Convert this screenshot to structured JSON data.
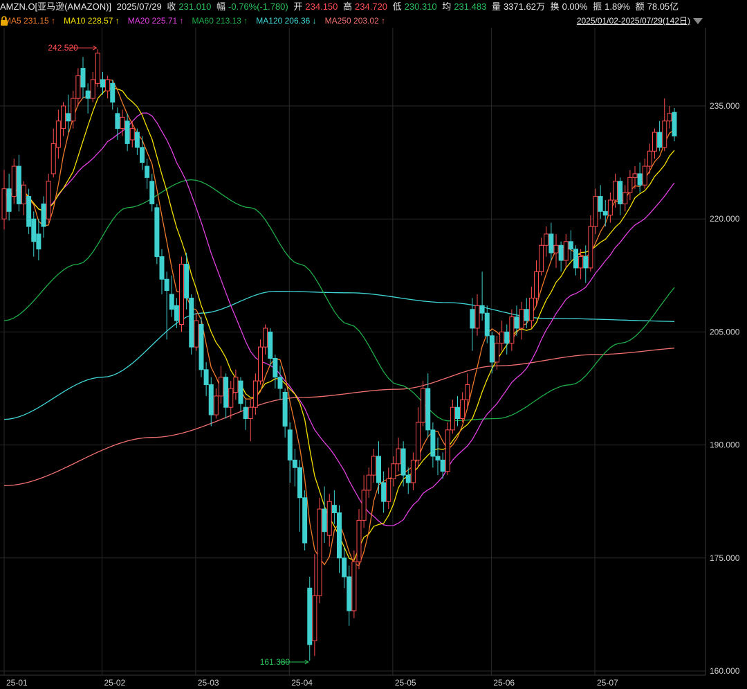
{
  "header": {
    "symbol": "AMZN.O[亚马逊(AMAZON)]",
    "date": "2025/07/29",
    "close_label": "收",
    "close": "231.010",
    "change_label": "幅",
    "change": "-0.76%(-1.780)",
    "open_label": "开",
    "open": "234.150",
    "high_label": "高",
    "high": "234.720",
    "low_label": "低",
    "low": "230.310",
    "avg_label": "均",
    "avg": "231.483",
    "volume_label": "量",
    "volume": "3371.62万",
    "turnover_label": "换",
    "turnover": "0.00%",
    "amplitude_label": "振",
    "amplitude": "1.89%",
    "amount_label": "额",
    "amount": "78.05亿"
  },
  "ma_legend": [
    {
      "label": "MA5",
      "value": "231.15",
      "arrow": "↑",
      "color": "#f07a2a"
    },
    {
      "label": "MA10",
      "value": "228.57",
      "arrow": "↑",
      "color": "#f5e100"
    },
    {
      "label": "MA20",
      "value": "225.71",
      "arrow": "↑",
      "color": "#e040e0"
    },
    {
      "label": "MA60",
      "value": "213.13",
      "arrow": "↑",
      "color": "#1fae4a"
    },
    {
      "label": "MA120",
      "value": "206.36",
      "arrow": "↓",
      "color": "#40d6d6"
    },
    {
      "label": "MA250",
      "value": "203.02",
      "arrow": "↑",
      "color": "#f07070"
    }
  ],
  "range_label": "2025/01/02-2025/07/29(142日)",
  "colors": {
    "up": "#ff4d4f",
    "down": "#3fd0d0",
    "grid": "#2a2a2a",
    "bg": "#000000"
  },
  "icons": [
    "dropdown-arrow-icon",
    "lock-icon"
  ],
  "chart_data": {
    "type": "candlestick",
    "ylim": [
      160,
      242.6
    ],
    "y_ticks": [
      "235.000",
      "220.000",
      "205.000",
      "190.000",
      "175.000",
      "160.000"
    ],
    "x_ticks": [
      "25-01",
      "25-02",
      "25-03",
      "25-04",
      "25-05",
      "25-06",
      "25-07"
    ],
    "annotations": [
      {
        "text": "242.520",
        "kind": "high",
        "value": 242.52
      },
      {
        "text": "161.380",
        "kind": "low",
        "value": 161.38
      }
    ],
    "candles": [
      [
        220.0,
        224.0,
        226.5,
        218.6
      ],
      [
        224.0,
        221.0,
        226.0,
        219.8
      ],
      [
        223.0,
        227.0,
        228.0,
        222.0
      ],
      [
        227.0,
        222.0,
        228.5,
        221.0
      ],
      [
        222.0,
        224.5,
        225.0,
        220.5
      ],
      [
        223.0,
        219.0,
        224.0,
        218.0
      ],
      [
        220.0,
        217.0,
        221.0,
        215.0
      ],
      [
        218.0,
        216.0,
        220.0,
        214.5
      ],
      [
        222.0,
        219.0,
        223.0,
        217.5
      ],
      [
        220.0,
        225.0,
        226.0,
        219.5
      ],
      [
        226.0,
        230.0,
        232.0,
        225.5
      ],
      [
        229.5,
        233.0,
        234.5,
        228.0
      ],
      [
        232.0,
        235.0,
        235.5,
        231.0
      ],
      [
        234.0,
        233.0,
        236.5,
        231.5
      ],
      [
        233.0,
        236.0,
        237.0,
        232.0
      ],
      [
        236.0,
        239.0,
        240.0,
        235.0
      ],
      [
        240.0,
        237.5,
        241.5,
        236.0
      ],
      [
        237.0,
        236.0,
        238.0,
        234.0
      ],
      [
        236.0,
        238.5,
        239.5,
        235.5
      ],
      [
        238.0,
        242.0,
        242.52,
        237.5
      ],
      [
        238.5,
        237.5,
        239.5,
        236.5
      ],
      [
        237.0,
        238.5,
        239.0,
        236.0
      ],
      [
        238.0,
        235.5,
        238.5,
        234.5
      ],
      [
        234.0,
        232.0,
        234.8,
        230.5
      ],
      [
        232.0,
        233.5,
        234.5,
        231.0
      ],
      [
        233.0,
        230.0,
        234.0,
        229.0
      ],
      [
        230.5,
        232.0,
        233.0,
        229.5
      ],
      [
        231.5,
        229.5,
        232.0,
        228.5
      ],
      [
        229.5,
        227.5,
        231.0,
        226.5
      ],
      [
        227.0,
        225.5,
        228.0,
        224.0
      ],
      [
        225.0,
        222.0,
        226.0,
        221.0
      ],
      [
        221.5,
        215.0,
        222.0,
        214.0
      ],
      [
        215.0,
        212.0,
        216.0,
        210.0
      ],
      [
        212.0,
        210.5,
        213.0,
        204.0
      ],
      [
        210.0,
        208.0,
        212.5,
        207.0
      ],
      [
        208.5,
        206.5,
        209.5,
        205.5
      ],
      [
        206.0,
        214.0,
        215.0,
        205.0
      ],
      [
        214.0,
        209.5,
        215.5,
        208.0
      ],
      [
        209.5,
        203.0,
        210.0,
        202.0
      ],
      [
        203.0,
        206.5,
        207.5,
        202.5
      ],
      [
        206.0,
        200.0,
        207.0,
        199.0
      ],
      [
        200.0,
        198.0,
        201.0,
        196.5
      ],
      [
        198.0,
        194.0,
        199.0,
        192.5
      ],
      [
        194.0,
        196.5,
        197.5,
        193.5
      ],
      [
        196.5,
        199.0,
        200.5,
        195.5
      ],
      [
        199.0,
        195.0,
        199.5,
        193.5
      ],
      [
        195.0,
        197.5,
        198.5,
        193.5
      ],
      [
        197.0,
        199.0,
        200.0,
        196.0
      ],
      [
        198.5,
        195.5,
        199.0,
        194.5
      ],
      [
        195.0,
        193.5,
        196.0,
        192.0
      ],
      [
        193.5,
        195.0,
        196.0,
        190.5
      ],
      [
        195.0,
        198.5,
        199.5,
        194.0
      ],
      [
        198.5,
        203.0,
        204.0,
        198.0
      ],
      [
        203.0,
        205.5,
        206.0,
        202.0
      ],
      [
        205.0,
        201.5,
        205.5,
        200.5
      ],
      [
        201.5,
        199.0,
        202.0,
        197.5
      ],
      [
        199.0,
        197.5,
        200.5,
        196.0
      ],
      [
        197.0,
        192.5,
        197.5,
        191.0
      ],
      [
        192.0,
        188.0,
        193.0,
        185.0
      ],
      [
        188.0,
        187.0,
        189.5,
        184.5
      ],
      [
        187.0,
        183.0,
        188.0,
        178.5
      ],
      [
        183.0,
        177.0,
        184.0,
        176.0
      ],
      [
        171.0,
        163.5,
        172.5,
        161.38
      ],
      [
        164.0,
        170.0,
        175.5,
        162.0
      ],
      [
        170.0,
        181.5,
        183.0,
        169.0
      ],
      [
        181.5,
        178.5,
        184.5,
        177.0
      ],
      [
        178.0,
        182.5,
        183.5,
        176.5
      ],
      [
        182.0,
        181.0,
        184.0,
        179.5
      ],
      [
        181.0,
        175.0,
        182.0,
        173.0
      ],
      [
        175.0,
        172.5,
        176.5,
        171.0
      ],
      [
        172.5,
        168.0,
        174.0,
        166.0
      ],
      [
        168.0,
        174.5,
        176.0,
        167.0
      ],
      [
        174.5,
        180.0,
        181.5,
        173.5
      ],
      [
        180.0,
        184.0,
        186.0,
        179.0
      ],
      [
        184.0,
        186.0,
        187.0,
        183.0
      ],
      [
        186.0,
        188.5,
        189.5,
        185.0
      ],
      [
        188.5,
        185.0,
        190.5,
        183.5
      ],
      [
        185.0,
        182.5,
        186.5,
        181.0
      ],
      [
        182.5,
        185.5,
        187.0,
        181.5
      ],
      [
        185.5,
        187.5,
        188.5,
        184.5
      ],
      [
        187.5,
        189.5,
        191.0,
        186.5
      ],
      [
        189.5,
        186.0,
        190.5,
        184.5
      ],
      [
        186.0,
        185.0,
        187.0,
        183.5
      ],
      [
        185.0,
        188.0,
        189.0,
        184.0
      ],
      [
        188.0,
        193.0,
        195.0,
        187.0
      ],
      [
        193.0,
        197.5,
        198.5,
        192.5
      ],
      [
        197.5,
        192.0,
        199.5,
        191.0
      ],
      [
        192.0,
        188.5,
        193.0,
        187.0
      ],
      [
        188.5,
        188.0,
        191.0,
        186.0
      ],
      [
        188.0,
        186.5,
        189.0,
        185.5
      ],
      [
        186.5,
        192.0,
        193.0,
        186.0
      ],
      [
        192.0,
        195.0,
        196.0,
        191.5
      ],
      [
        195.0,
        193.5,
        196.5,
        192.5
      ],
      [
        193.5,
        196.0,
        197.0,
        193.0
      ],
      [
        196.0,
        198.0,
        199.5,
        195.0
      ],
      [
        208.0,
        205.5,
        209.5,
        202.5
      ],
      [
        205.5,
        208.5,
        210.0,
        204.5
      ],
      [
        208.5,
        207.5,
        213.0,
        206.5
      ],
      [
        207.5,
        204.5,
        208.5,
        203.5
      ],
      [
        204.5,
        201.0,
        205.0,
        199.5
      ],
      [
        201.0,
        203.5,
        204.5,
        200.0
      ],
      [
        203.5,
        205.0,
        206.5,
        202.5
      ],
      [
        205.0,
        203.5,
        206.0,
        202.0
      ],
      [
        203.5,
        207.0,
        208.0,
        202.5
      ],
      [
        207.0,
        205.5,
        208.5,
        204.5
      ],
      [
        205.5,
        208.0,
        209.0,
        204.0
      ],
      [
        208.0,
        206.5,
        209.5,
        205.5
      ],
      [
        206.5,
        209.5,
        211.0,
        205.5
      ],
      [
        209.5,
        213.0,
        214.5,
        208.5
      ],
      [
        213.0,
        216.5,
        217.5,
        212.5
      ],
      [
        216.5,
        218.0,
        219.0,
        215.0
      ],
      [
        218.0,
        215.5,
        219.5,
        214.5
      ],
      [
        215.5,
        216.5,
        218.0,
        213.5
      ],
      [
        216.5,
        214.5,
        217.0,
        213.0
      ],
      [
        214.5,
        217.0,
        218.0,
        213.5
      ],
      [
        217.0,
        216.0,
        218.5,
        214.5
      ],
      [
        216.0,
        213.5,
        216.5,
        212.5
      ],
      [
        213.5,
        215.0,
        216.0,
        212.0
      ],
      [
        215.0,
        213.5,
        216.5,
        211.5
      ],
      [
        213.5,
        219.0,
        220.5,
        213.0
      ],
      [
        219.0,
        223.0,
        224.0,
        218.0
      ],
      [
        223.0,
        221.0,
        224.5,
        220.0
      ],
      [
        221.0,
        220.5,
        222.5,
        219.0
      ],
      [
        220.5,
        222.5,
        223.5,
        219.5
      ],
      [
        222.5,
        225.0,
        226.0,
        221.5
      ],
      [
        225.0,
        222.0,
        225.5,
        220.5
      ],
      [
        222.0,
        223.5,
        224.5,
        221.0
      ],
      [
        223.5,
        225.5,
        226.5,
        222.5
      ],
      [
        225.5,
        226.0,
        227.0,
        224.0
      ],
      [
        226.0,
        224.5,
        227.5,
        223.5
      ],
      [
        224.5,
        227.0,
        228.0,
        224.0
      ],
      [
        227.0,
        229.0,
        230.0,
        226.0
      ],
      [
        229.0,
        231.5,
        232.0,
        228.0
      ],
      [
        231.5,
        229.5,
        233.0,
        229.0
      ],
      [
        229.5,
        233.0,
        236.0,
        229.0
      ],
      [
        233.0,
        234.0,
        235.0,
        232.0
      ],
      [
        234.15,
        231.01,
        234.72,
        230.31
      ]
    ]
  }
}
